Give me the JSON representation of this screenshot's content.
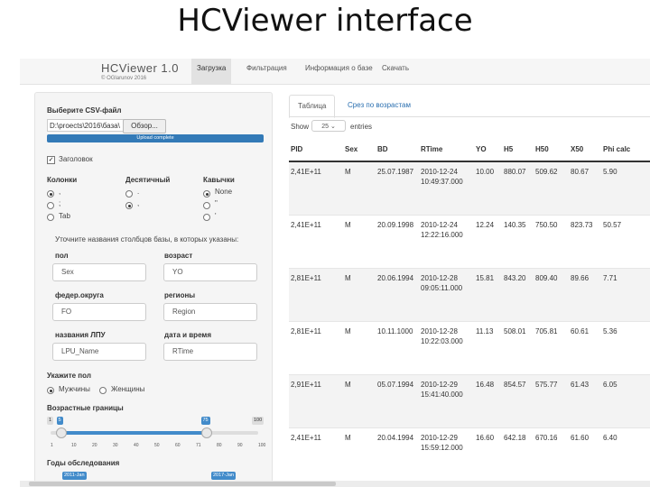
{
  "slide": {
    "title": "HCViewer interface"
  },
  "app": {
    "brand": "HCViewer 1.0",
    "brand_sub": "© OGlarunov 2016",
    "nav": [
      "Загрузка",
      "Фильтрация",
      "Информация о базе",
      "Скачать"
    ]
  },
  "sidebar": {
    "file_label": "Выберите CSV-файл",
    "file_path": "D:\\proects\\2016\\база\\",
    "browse_label": "Обзор...",
    "upload_status": "Upload complete",
    "header_checkbox": "Заголовок",
    "columns_label": "Колонки",
    "columns_options": [
      ",",
      ";",
      "Tab"
    ],
    "decimal_label": "Десятичный",
    "decimal_options": [
      ".",
      ","
    ],
    "quotes_label": "Кавычки",
    "quotes_options": [
      "None",
      "\"",
      "'"
    ],
    "names_hint": "Уточните названия столбцов базы, в которых указаны:",
    "fields": [
      {
        "label": "пол",
        "value": "Sex"
      },
      {
        "label": "возраст",
        "value": "YO"
      },
      {
        "label": "федер.округа",
        "value": "FO"
      },
      {
        "label": "регионы",
        "value": "Region"
      },
      {
        "label": "названия ЛПУ",
        "value": "LPU_Name"
      },
      {
        "label": "дата и время",
        "value": "RTime"
      }
    ],
    "sex_label": "Укажите пол",
    "sex_options": [
      "Мужчины",
      "Женщины"
    ],
    "age_label": "Возрастные границы",
    "age_min": "1",
    "age_max": "100",
    "age_low": "5",
    "age_high": "75",
    "age_low_frac": 0.05,
    "age_high_frac": 0.75,
    "age_ticks": [
      "1",
      "10",
      "20",
      "30",
      "40",
      "50",
      "60",
      "71",
      "80",
      "90",
      "100"
    ],
    "years_label": "Годы обследования",
    "years_low": "2011-Jan",
    "years_high": "2017-Jan"
  },
  "main": {
    "tabs": [
      "Таблица",
      "Срез по возрастам"
    ],
    "show_label": "Show",
    "show_value": "25",
    "entries_label": "entries",
    "columns": [
      "PID",
      "Sex",
      "BD",
      "RTime",
      "YO",
      "H5",
      "H50",
      "X50",
      "Phi calc"
    ],
    "rows": [
      [
        "2,41E+11",
        "M",
        "25.07.1987",
        "2010-12-24\n10:49:37.000",
        "10.00",
        "880.07",
        "509.62",
        "80.67",
        "5.90"
      ],
      [
        "2,41E+11",
        "M",
        "20.09.1998",
        "2010-12-24\n12:22:16.000",
        "12.24",
        "140.35",
        "750.50",
        "823.73",
        "50.57"
      ],
      [
        "2,81E+11",
        "M",
        "20.06.1994",
        "2010-12-28\n09:05:11.000",
        "15.81",
        "843.20",
        "809.40",
        "89.66",
        "7.71"
      ],
      [
        "2,81E+11",
        "M",
        "10.11.1000",
        "2010-12-28\n10:22:03.000",
        "11.13",
        "508.01",
        "705.81",
        "60.61",
        "5.36"
      ],
      [
        "2,91E+11",
        "M",
        "05.07.1994",
        "2010-12-29\n15:41:40.000",
        "16.48",
        "854.57",
        "575.77",
        "61.43",
        "6.05"
      ],
      [
        "2,41E+11",
        "M",
        "20.04.1994",
        "2010-12-29\n15:59:12.000",
        "16.60",
        "642.18",
        "670.16",
        "61.60",
        "6.40"
      ]
    ]
  }
}
